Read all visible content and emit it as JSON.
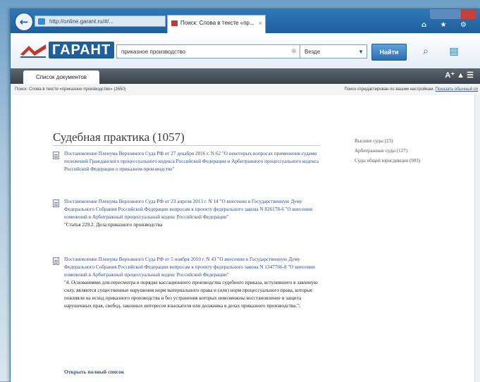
{
  "browser": {
    "address": "http://online.garant.ru/#/...",
    "tab_title": "Поиск: Слова в тексте «пр...",
    "tab_close": "×",
    "back_icon": "←",
    "toolbar_icons": "⌂ ★ ⚙"
  },
  "garant": {
    "logo": "ГАРАНТ",
    "search_value": "приказное производство",
    "search_clear": "⊗",
    "scope_value": "Везде",
    "find_label": "Найти"
  },
  "nav": {
    "tab_label": "Список документов",
    "right_controls": "A⁺ ▲   ☰"
  },
  "info": {
    "left": "Поиск: Слова в тексте «приказное производство» (2650)",
    "right_prefix": "Поиск отредактирован по вашим настройкам.",
    "right_link": "Показать обычный сп"
  },
  "results": {
    "title": "Судебная практика (1057)",
    "open_all": "Открыть полный список",
    "docs": [
      {
        "link": "Постановление Пленума Верховного Суда РФ от 27 декабря 2016 г. N 62 \"О некоторых вопросах применения судами положений Гражданского процессуального кодекса Российской Федерации и Арбитражного процессуального кодекса Российской Федерации о приказном производстве\"",
        "note": ""
      },
      {
        "link": "Постановление Пленума Верховного Суда РФ от 23 апреля 2013 г. N 14 \"О внесении в Государственную Думу Федерального Собрания Российской Федерации вопросам к проекту федерального закона N 826178-6 \"О внесении изменений в Арбитражный процессуальный кодекс Российской Федерации\"",
        "note": "\"Статья 229.2. Дела приказного производства"
      },
      {
        "link": "Постановление Пленума Верховного Суда РФ от 5 ноября 2010 г. N 43 \"О внесении в Государственную Думу Федерального Собрания Российской Федерации вопросам к проекту федерального закона N 1347766-8 \"О внесении изменений в Арбитражный процессуальный кодекс Российской Федерации\"",
        "note": "\"4. Основаниями для пересмотра в порядке кассационного производства судебного приказа, вступившего в законную силу, являются существенные нарушения норм материального права и (или) норм процессуального права, которые повлияли на исход приказного производства и без устранения которых невозможны восстановление и защита нарушенных прав, свобод, законных интересов взыскателя или должника в делах приказного производства.\";"
      }
    ]
  },
  "facets": [
    "Высшие суды (23)",
    "Арбитражные суды (127)",
    "Суды общей юрисдикции (903)"
  ],
  "colors": {
    "accent": "#1f5f9c",
    "link": "#2d4f8c",
    "nav_dark": "#3a434c"
  }
}
